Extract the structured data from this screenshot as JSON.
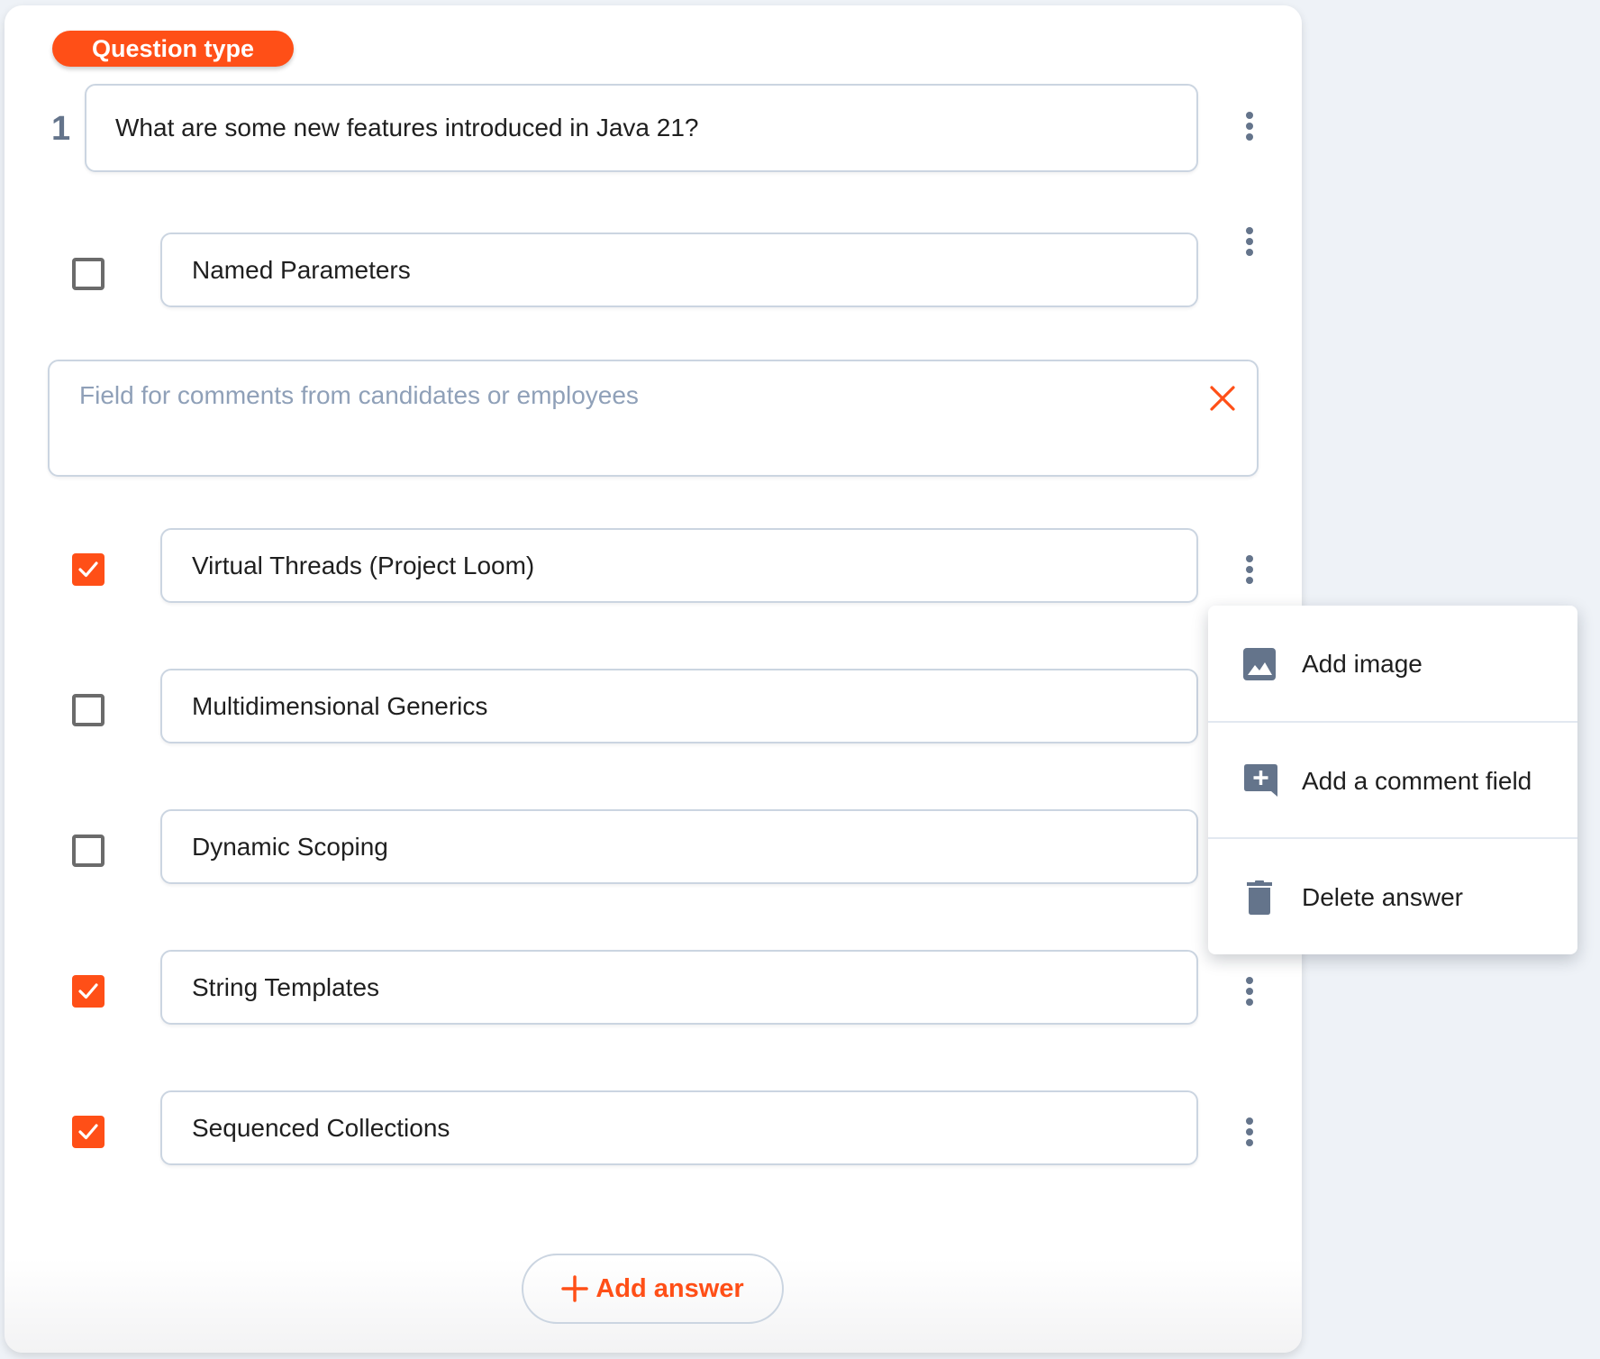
{
  "colors": {
    "accent": "#FF4F17",
    "icon": "#64748B",
    "border": "#CBD5E1",
    "placeholder": "#8FA0B8",
    "background": "#EEF2F7"
  },
  "question": {
    "type_badge": "Question type",
    "number": "1",
    "text": "What are some new features introduced in Java 21?"
  },
  "answers": [
    {
      "text": "Named Parameters",
      "checked": false
    },
    {
      "text": "Virtual Threads (Project Loom)",
      "checked": true
    },
    {
      "text": "Multidimensional Generics",
      "checked": false
    },
    {
      "text": "Dynamic Scoping",
      "checked": false
    },
    {
      "text": "String Templates",
      "checked": true
    },
    {
      "text": "Sequenced Collections",
      "checked": true
    }
  ],
  "comment_field": {
    "placeholder": "Field for comments from candidates or employees",
    "value": ""
  },
  "add_answer_label": "Add answer",
  "context_menu": {
    "items": [
      {
        "label": "Add image",
        "icon": "image-icon"
      },
      {
        "label": "Add a comment field",
        "icon": "add-comment-icon"
      },
      {
        "label": "Delete answer",
        "icon": "trash-icon"
      }
    ]
  }
}
